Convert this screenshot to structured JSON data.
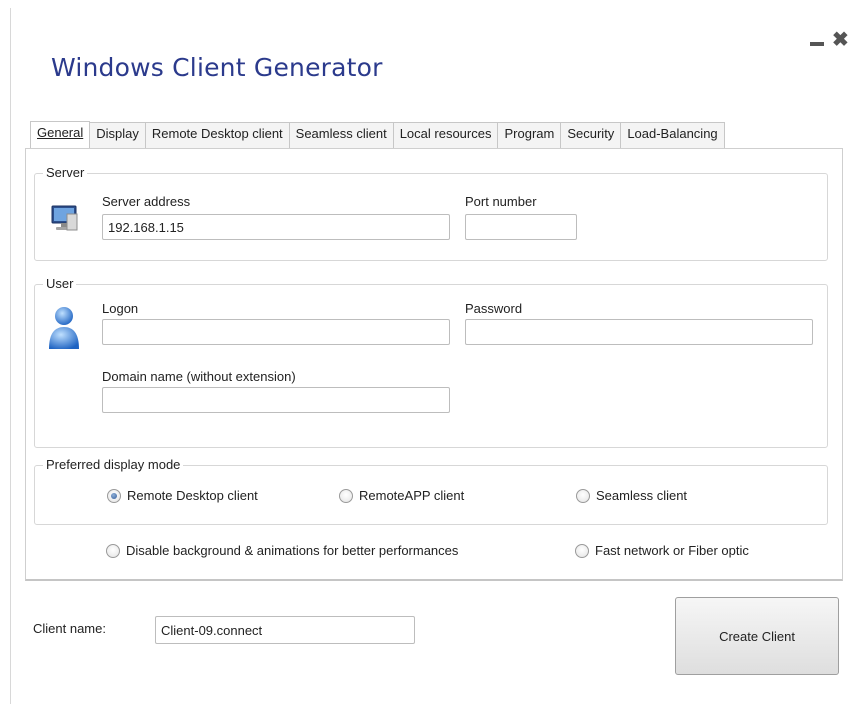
{
  "window": {
    "title": "Windows Client Generator"
  },
  "tabs": [
    {
      "label": "General"
    },
    {
      "label": "Display"
    },
    {
      "label": "Remote Desktop client"
    },
    {
      "label": "Seamless client"
    },
    {
      "label": "Local resources"
    },
    {
      "label": "Program"
    },
    {
      "label": "Security"
    },
    {
      "label": "Load-Balancing"
    }
  ],
  "server": {
    "legend": "Server",
    "address_label": "Server address",
    "address_value": "192.168.1.15",
    "port_label": "Port number",
    "port_value": ""
  },
  "user": {
    "legend": "User",
    "logon_label": "Logon",
    "logon_value": "",
    "password_label": "Password",
    "password_value": "",
    "domain_label": "Domain name (without extension)",
    "domain_value": ""
  },
  "display_mode": {
    "legend": "Preferred display mode",
    "options": [
      {
        "label": "Remote Desktop client",
        "checked": true
      },
      {
        "label": "RemoteAPP client",
        "checked": false
      },
      {
        "label": "Seamless client",
        "checked": false
      }
    ]
  },
  "extras": {
    "disable_bg_label": "Disable background & animations for better performances",
    "fast_network_label": "Fast network or Fiber optic"
  },
  "footer": {
    "client_name_label": "Client name:",
    "client_name_value": "Client-09.connect",
    "create_button": "Create Client"
  },
  "colors": {
    "title": "#2b3a8c",
    "radio_dot": "#355d9a"
  },
  "icons": [
    "minimize-icon",
    "close-icon",
    "computer-monitor-icon",
    "user-person-icon"
  ]
}
